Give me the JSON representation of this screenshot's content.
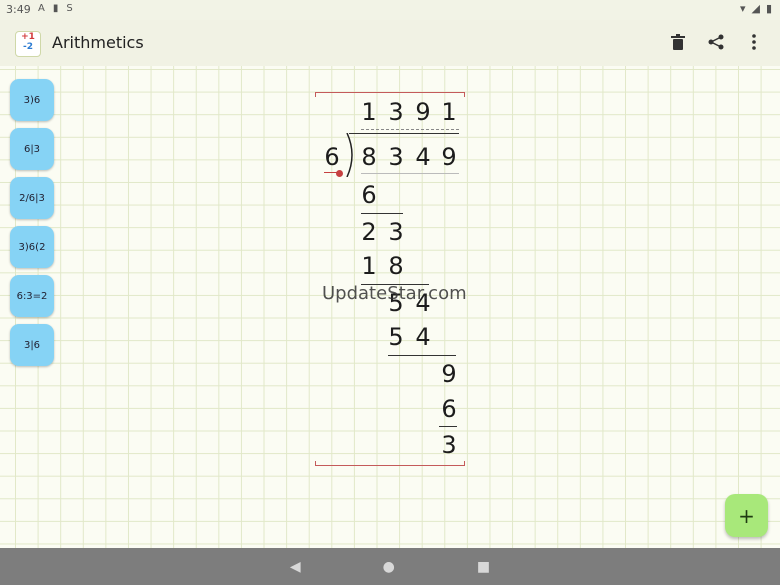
{
  "status": {
    "time": "3:49",
    "left_icons": [
      "A",
      "▮",
      "S"
    ],
    "right_icons": [
      "▾",
      "◢",
      "▮"
    ]
  },
  "app": {
    "title": "Arithmetics",
    "icon_top": "+1",
    "icon_bottom": "-2"
  },
  "tools": [
    {
      "id": "long-division",
      "label": "3)6"
    },
    {
      "id": "fraction-divide",
      "label": "6|3"
    },
    {
      "id": "fraction-stacked",
      "label": "2/6|3"
    },
    {
      "id": "division-bracket",
      "label": "3)6(2"
    },
    {
      "id": "division-inline",
      "label": "6:3=2"
    },
    {
      "id": "table-division",
      "label": "3|6"
    }
  ],
  "division": {
    "quotient": [
      "1",
      "3",
      "9",
      "1"
    ],
    "divisor": "6",
    "dividend": [
      "8",
      "3",
      "4",
      "9"
    ],
    "steps": [
      {
        "digits": [
          "6"
        ],
        "row": 0
      },
      {
        "digits": [
          "2",
          "3"
        ],
        "row": 1
      },
      {
        "digits": [
          "1",
          "8"
        ],
        "row": 2
      },
      {
        "digits": [
          "5",
          "4"
        ],
        "row": 3
      },
      {
        "digits": [
          "5",
          "4"
        ],
        "row": 4
      },
      {
        "digits": [
          "9"
        ],
        "row": 5
      },
      {
        "digits": [
          "6"
        ],
        "row": 6
      },
      {
        "digits": [
          "3"
        ],
        "row": 7
      }
    ]
  },
  "watermark": "UpdateStar.com",
  "fab_label": "+",
  "nav": {
    "back": "◀",
    "home": "●",
    "recent": "■"
  }
}
